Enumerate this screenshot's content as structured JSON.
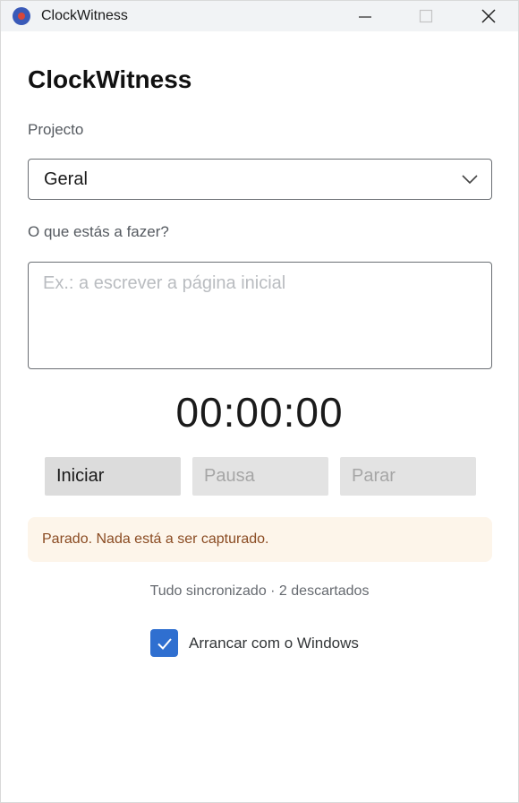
{
  "window": {
    "title": "ClockWitness",
    "icon": "record-dot-icon",
    "controls": [
      "minimize-icon",
      "maximize-icon",
      "close-icon"
    ]
  },
  "app": {
    "heading": "ClockWitness"
  },
  "project": {
    "label": "Projecto",
    "selected": "Geral"
  },
  "task": {
    "label": "O que estás a fazer?",
    "placeholder": "Ex.: a escrever a página inicial",
    "value": ""
  },
  "timer": {
    "display": "00:00:00"
  },
  "controls": {
    "start_label": "Iniciar",
    "pause_label": "Pausa",
    "stop_label": "Parar"
  },
  "status": {
    "message": "Parado. Nada está a ser capturado."
  },
  "sync": {
    "text": "Tudo sincronizado · 2 descartados"
  },
  "startup": {
    "label": "Arrancar com o Windows",
    "checked": true
  },
  "colors": {
    "accent": "#2f6fd0",
    "status_bg": "#fdf5ea",
    "status_text": "#8a4b22",
    "icon_ring": "#3a5ab8",
    "icon_dot": "#d8473a"
  }
}
